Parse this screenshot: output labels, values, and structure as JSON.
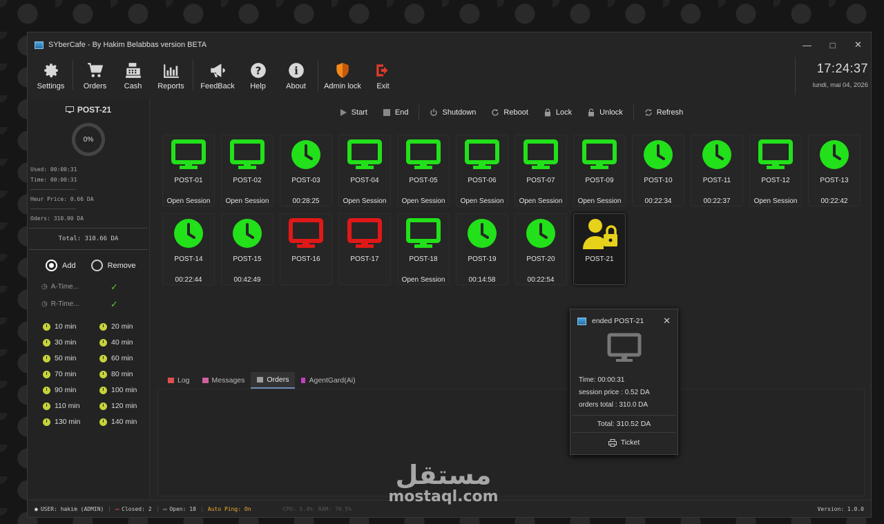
{
  "window": {
    "title": "SYberCafe - By Hakim Belabbas version BETA"
  },
  "toolbar": {
    "items": [
      {
        "label": "Settings",
        "icon": "gear-icon"
      },
      {
        "label": "Orders",
        "icon": "cart-icon"
      },
      {
        "label": "Cash",
        "icon": "cash-register-icon"
      },
      {
        "label": "Reports",
        "icon": "bar-chart-icon"
      },
      {
        "label": "FeedBack",
        "icon": "megaphone-icon"
      },
      {
        "label": "Help",
        "icon": "question-icon"
      },
      {
        "label": "About",
        "icon": "info-icon"
      },
      {
        "label": "Admin lock",
        "icon": "shield-icon"
      },
      {
        "label": "Exit",
        "icon": "exit-icon"
      }
    ]
  },
  "clock": {
    "time": "17:24:37",
    "date": "lundi, mai 04, 2026"
  },
  "sidebar": {
    "post": "POST-21",
    "progress": "0%",
    "used": "Used: 00:00:31",
    "time": "Time: 00:00:31",
    "hour_price": "Heur Price: 0.66 DA",
    "orders": "Oders: 310.00 DA",
    "total": "Total: 310.66 DA",
    "radio_add": "Add",
    "radio_remove": "Remove",
    "a_time": "A-Time...",
    "r_time": "R-Time...",
    "minutes": [
      "10 min",
      "20 min",
      "30 min",
      "40 min",
      "50 min",
      "60 min",
      "70 min",
      "80 min",
      "90 min",
      "100 min",
      "110 min",
      "120 min",
      "130 min",
      "140 min"
    ]
  },
  "actions": [
    "Start",
    "End",
    "Shutdown",
    "Reboot",
    "Lock",
    "Unlock",
    "Refresh"
  ],
  "posts": [
    {
      "name": "POST-01",
      "status": "Open Session",
      "icon": "monitor",
      "color": "#22e01a"
    },
    {
      "name": "POST-02",
      "status": "Open Session",
      "icon": "monitor",
      "color": "#22e01a"
    },
    {
      "name": "POST-03",
      "status": "00:28:25",
      "icon": "clock",
      "color": "#22e01a"
    },
    {
      "name": "POST-04",
      "status": "Open Session",
      "icon": "monitor",
      "color": "#22e01a"
    },
    {
      "name": "POST-05",
      "status": "Open Session",
      "icon": "monitor",
      "color": "#22e01a"
    },
    {
      "name": "POST-06",
      "status": "Open Session",
      "icon": "monitor",
      "color": "#22e01a"
    },
    {
      "name": "POST-07",
      "status": "Open Session",
      "icon": "monitor",
      "color": "#22e01a"
    },
    {
      "name": "POST-09",
      "status": "Open Session",
      "icon": "monitor",
      "color": "#22e01a"
    },
    {
      "name": "POST-10",
      "status": "00:22:34",
      "icon": "clock",
      "color": "#22e01a"
    },
    {
      "name": "POST-11",
      "status": "00:22:37",
      "icon": "clock",
      "color": "#22e01a"
    },
    {
      "name": "POST-12",
      "status": "Open Session",
      "icon": "monitor",
      "color": "#22e01a"
    },
    {
      "name": "POST-13",
      "status": "00:22:42",
      "icon": "clock",
      "color": "#22e01a"
    },
    {
      "name": "POST-14",
      "status": "00:22:44",
      "icon": "clock",
      "color": "#22e01a"
    },
    {
      "name": "POST-15",
      "status": "00:42:49",
      "icon": "clock",
      "color": "#22e01a"
    },
    {
      "name": "POST-16",
      "status": "",
      "icon": "monitor",
      "color": "#e01818"
    },
    {
      "name": "POST-17",
      "status": "",
      "icon": "monitor",
      "color": "#e01818"
    },
    {
      "name": "POST-18",
      "status": "Open Session",
      "icon": "monitor",
      "color": "#22e01a"
    },
    {
      "name": "POST-19",
      "status": "00:14:58",
      "icon": "clock",
      "color": "#22e01a"
    },
    {
      "name": "POST-20",
      "status": "00:22:54",
      "icon": "clock",
      "color": "#22e01a"
    },
    {
      "name": "POST-21",
      "status": "",
      "icon": "user-lock",
      "color": "#e6d21a"
    }
  ],
  "tabs": [
    {
      "label": "Log",
      "icon": "log-icon",
      "color": "#e05050"
    },
    {
      "label": "Messages",
      "icon": "mail-icon",
      "color": "#d060a0"
    },
    {
      "label": "Orders",
      "icon": "orders-icon",
      "color": "#a0a0a0"
    },
    {
      "label": "AgentGard(Ai)",
      "icon": "agent-icon",
      "color": "#c040c0"
    }
  ],
  "statusbar": {
    "user": "USER: hakim (ADMIN)",
    "closed": "Closed: 2",
    "open": "Open: 18",
    "ping": "Auto Ping: On",
    "cpu": "CPU: 5.4%",
    "ram": "RAM: 70.5%",
    "version": "Version: 1.0.0"
  },
  "popup": {
    "title": "ended POST-21",
    "time": "Time: 00:00:31",
    "session_price": "session price : 0.52 DA",
    "orders_total": "orders total : 310.0 DA",
    "total": "Total: 310.52 DA",
    "ticket": "Ticket"
  },
  "watermark": {
    "arabic": "مستقل",
    "latin": "mostaql.com"
  }
}
